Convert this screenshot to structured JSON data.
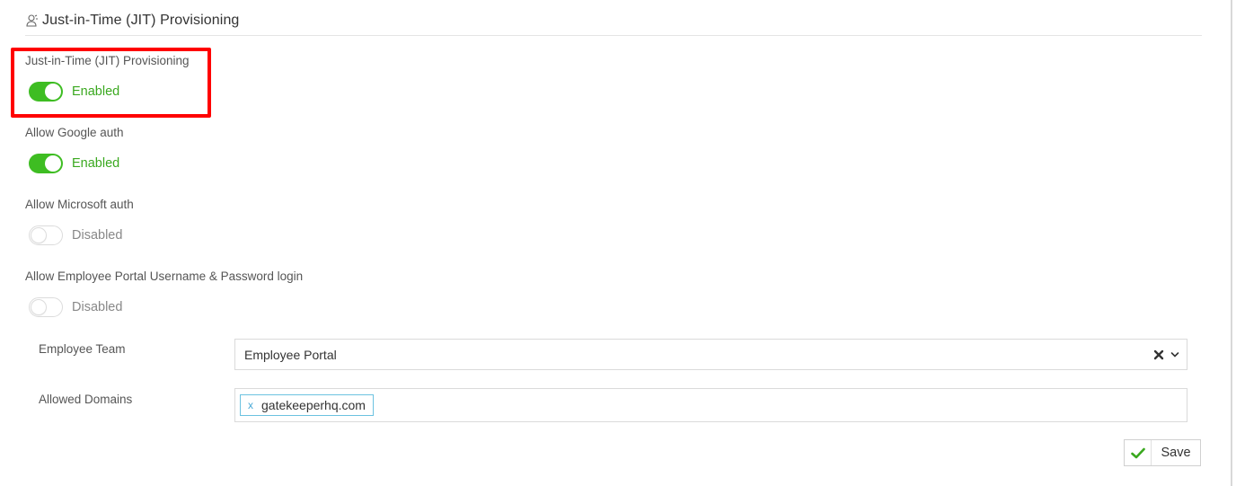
{
  "header": {
    "icon": "user-provision-icon",
    "title": "Just-in-Time (JIT) Provisioning"
  },
  "settings": [
    {
      "label": "Just-in-Time (JIT) Provisioning",
      "state": "Enabled",
      "on": true
    },
    {
      "label": "Allow Google auth",
      "state": "Enabled",
      "on": true
    },
    {
      "label": "Allow Microsoft auth",
      "state": "Disabled",
      "on": false
    },
    {
      "label": "Allow Employee Portal Username & Password login",
      "state": "Disabled",
      "on": false
    }
  ],
  "employee_team": {
    "label": "Employee Team",
    "value": "Employee Portal",
    "clear_icon": "close-icon",
    "dropdown_icon": "chevron-down-icon"
  },
  "allowed_domains": {
    "label": "Allowed Domains",
    "tags": [
      {
        "remove_label": "x",
        "text": "gatekeeperhq.com"
      }
    ]
  },
  "save": {
    "label": "Save",
    "icon": "check-icon"
  },
  "colors": {
    "toggle_on": "#3ebd22",
    "enabled_text": "#3aa81f",
    "highlight": "#ff0000",
    "tag_border": "#6cc2e0",
    "check": "#3aa81f"
  }
}
